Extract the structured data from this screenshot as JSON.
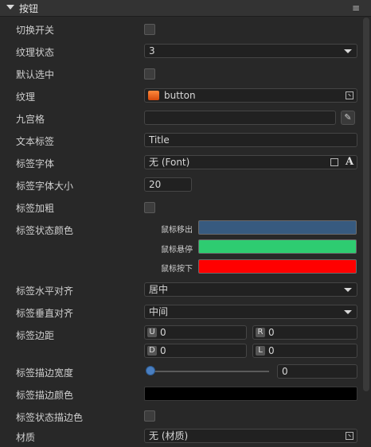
{
  "section": {
    "title": "按钮",
    "menu_glyph": "≡"
  },
  "rows": {
    "toggle": {
      "label": "切换开关",
      "checked": false
    },
    "texture_state": {
      "label": "纹理状态",
      "value": "3"
    },
    "default_selected": {
      "label": "默认选中",
      "checked": false
    },
    "texture": {
      "label": "纹理",
      "value": "button"
    },
    "nine_slice": {
      "label": "九宫格",
      "value": ""
    },
    "text_label": {
      "label": "文本标签",
      "value": "Title"
    },
    "label_font": {
      "label": "标签字体",
      "value": "无 (Font)"
    },
    "label_font_size": {
      "label": "标签字体大小",
      "value": "20"
    },
    "label_bold": {
      "label": "标签加粗",
      "checked": false
    },
    "label_state_color": {
      "label": "标签状态颜色",
      "states": [
        {
          "name": "鼠标移出",
          "color": "#375a7f"
        },
        {
          "name": "鼠标悬停",
          "color": "#2ecc71"
        },
        {
          "name": "鼠标按下",
          "color": "#ff0000"
        }
      ]
    },
    "label_h_align": {
      "label": "标签水平对齐",
      "value": "居中"
    },
    "label_v_align": {
      "label": "标签垂直对齐",
      "value": "中间"
    },
    "label_padding": {
      "label": "标签边距",
      "U": "0",
      "R": "0",
      "D": "0",
      "L": "0",
      "tags": {
        "U": "U",
        "R": "R",
        "D": "D",
        "L": "L"
      }
    },
    "label_stroke_width": {
      "label": "标签描边宽度",
      "value": "0",
      "slider_fraction": 0
    },
    "label_stroke_color": {
      "label": "标签描边颜色",
      "color": "#000000"
    },
    "label_state_stroke": {
      "label": "标签状态描边色",
      "checked": false
    },
    "material": {
      "label": "材质",
      "value": "无 (材质)"
    }
  },
  "icons": {
    "collapse": "triangle-down-icon",
    "asset_picker": "asset-picker-icon",
    "edit": "pencil-icon",
    "font": "font-A-icon"
  }
}
